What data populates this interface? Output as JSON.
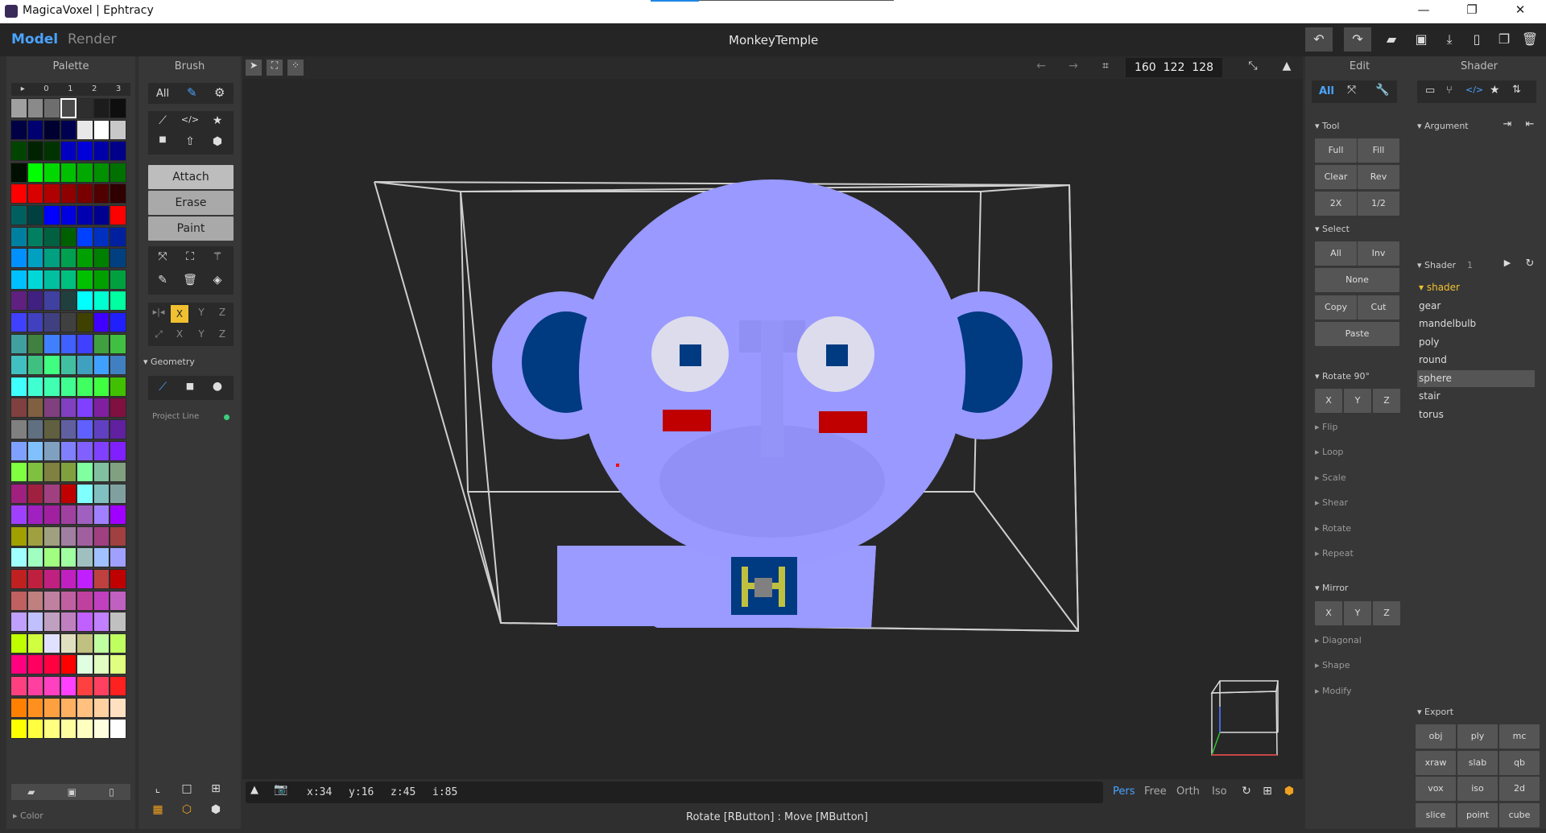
{
  "window": {
    "title": "MagicaVoxel | Ephtracy",
    "minimize": "—",
    "maximize": "❐",
    "close": "✕"
  },
  "menubar": {
    "model_tab": "Model",
    "render_tab": "Render",
    "project_name": "MonkeyTemple"
  },
  "palette": {
    "title": "Palette",
    "pages": [
      "▸",
      "0",
      "1",
      "2",
      "3"
    ],
    "footer_label": "Color",
    "colors": [
      [
        "#a0a0a0",
        "#8a8a8a",
        "#6e6e6e",
        "#4a4a4a",
        "#2e2e2e",
        "#1c1c1c",
        "#0e0e0e"
      ],
      [
        "#000044",
        "#000070",
        "#000030",
        "#000050",
        "#e8e8e8",
        "#ffffff",
        "#c8c8c8"
      ],
      [
        "#004400",
        "#002200",
        "#003300",
        "#0000c0",
        "#0000d8",
        "#0000a8",
        "#000088"
      ],
      [
        "#001000",
        "#00ff00",
        "#00d800",
        "#00c000",
        "#00a800",
        "#009000",
        "#007000"
      ],
      [
        "#ff0000",
        "#d80000",
        "#b00000",
        "#900000",
        "#780000",
        "#500000",
        "#300000"
      ],
      [
        "#006060",
        "#004040",
        "#0000ff",
        "#0000e0",
        "#0000b0",
        "#000090",
        "#ff0000"
      ],
      [
        "#0080a0",
        "#008060",
        "#006040",
        "#006000",
        "#0040ff",
        "#0030c0",
        "#0020a0"
      ],
      [
        "#0090ff",
        "#00a0c0",
        "#00a080",
        "#00a050",
        "#00a000",
        "#008000",
        "#004080"
      ],
      [
        "#00c0ff",
        "#00d8d8",
        "#00c0a0",
        "#00c080",
        "#00c000",
        "#00a000",
        "#00a040"
      ],
      [
        "#602080",
        "#402080",
        "#4040a0",
        "#204040",
        "#00ffff",
        "#00ffd0",
        "#00ffa0"
      ],
      [
        "#4040ff",
        "#4040c0",
        "#404080",
        "#404040",
        "#404000",
        "#4000ff",
        "#2020ff"
      ],
      [
        "#40a0a0",
        "#408040",
        "#4080ff",
        "#4060ff",
        "#4040ff",
        "#40a040",
        "#40c040"
      ],
      [
        "#40c0c0",
        "#40c080",
        "#40ff80",
        "#40c0a0",
        "#40a0c0",
        "#40a0ff",
        "#4080c0"
      ],
      [
        "#40ffff",
        "#40ffd0",
        "#40ffb0",
        "#40ff90",
        "#40ff60",
        "#40ff40",
        "#40c000"
      ],
      [
        "#804040",
        "#806040",
        "#804080",
        "#8040c0",
        "#8040ff",
        "#8020a0",
        "#801040"
      ],
      [
        "#808080",
        "#607080",
        "#606040",
        "#6060a0",
        "#6060ff",
        "#6040c0",
        "#6020a0"
      ],
      [
        "#80a0ff",
        "#80c0ff",
        "#80a0c0",
        "#8080ff",
        "#8060ff",
        "#8040ff",
        "#8020ff"
      ],
      [
        "#80ff40",
        "#80c040",
        "#808040",
        "#80a040",
        "#80ffa0",
        "#80c0a0",
        "#80a080"
      ],
      [
        "#a02080",
        "#a02040",
        "#a04080",
        "#c00000",
        "#80ffff",
        "#80c0c0",
        "#80a0a0"
      ],
      [
        "#a040ff",
        "#a020c0",
        "#a020a0",
        "#a040a0",
        "#a060c0",
        "#a080ff",
        "#a000ff"
      ],
      [
        "#a0a000",
        "#a0a040",
        "#a0a080",
        "#a080a0",
        "#a060a0",
        "#a04080",
        "#a04040"
      ],
      [
        "#a0ffff",
        "#a0ffc0",
        "#a0ff80",
        "#a0ffa0",
        "#a0c0c0",
        "#a0c0ff",
        "#a0a0ff"
      ],
      [
        "#c02020",
        "#c02040",
        "#c02080",
        "#c020c0",
        "#c020ff",
        "#c04040",
        "#c00000"
      ],
      [
        "#c06060",
        "#c08080",
        "#c080a0",
        "#c060a0",
        "#c040a0",
        "#c040c0",
        "#c060c0"
      ],
      [
        "#c0a0ff",
        "#c0c0ff",
        "#c0a0c0",
        "#c080c0",
        "#c060ff",
        "#c080ff",
        "#c0c0c0"
      ],
      [
        "#c0ff00",
        "#d0ff40",
        "#e0e0ff",
        "#e0e0c0",
        "#c0c080",
        "#c0ffa0",
        "#c0ff60"
      ],
      [
        "#ff0080",
        "#ff0060",
        "#ff0040",
        "#ff0000",
        "#e0ffe0",
        "#e0ffc0",
        "#e0ff80"
      ],
      [
        "#ff4080",
        "#ff40a0",
        "#ff40c0",
        "#ff40ff",
        "#ff4040",
        "#ff4060",
        "#ff2020"
      ],
      [
        "#ff8000",
        "#ff9020",
        "#ffa040",
        "#ffb060",
        "#ffc080",
        "#ffd0a0",
        "#ffe0c0"
      ],
      [
        "#ffff00",
        "#ffff40",
        "#ffff80",
        "#ffffa0",
        "#ffffc0",
        "#ffffe0",
        "#ffffff"
      ]
    ]
  },
  "brush": {
    "title": "Brush",
    "all_label": "All",
    "modes": {
      "attach": "Attach",
      "erase": "Erase",
      "paint": "Paint"
    },
    "axes": {
      "x": "X",
      "y": "Y",
      "z": "Z"
    },
    "geometry_label": "Geometry",
    "project_line_label": "Project Line"
  },
  "toolbar": {
    "size_x": "160",
    "size_y": "122",
    "size_z": "128"
  },
  "status": {
    "x": "x:34",
    "y": "y:16",
    "z": "z:45",
    "i": "i:85",
    "hint": "Rotate [RButton] : Move [MButton]"
  },
  "view": {
    "pers": "Pers",
    "free": "Free",
    "orth": "Orth",
    "iso": "Iso"
  },
  "edit": {
    "title": "Edit",
    "all_label": "All",
    "tool_label": "Tool",
    "tool_buttons": [
      "Full",
      "Fill",
      "Clear",
      "Rev",
      "2X",
      "1/2"
    ],
    "select_label": "Select",
    "select_all": "All",
    "select_inv": "Inv",
    "select_none": "None",
    "copy": "Copy",
    "cut": "Cut",
    "paste": "Paste",
    "rotate_label": "Rotate 90°",
    "rotate_axes": [
      "X",
      "Y",
      "Z"
    ],
    "collapsed": [
      "Flip",
      "Loop",
      "Scale",
      "Shear",
      "Rotate",
      "Repeat"
    ],
    "mirror_label": "Mirror",
    "mirror_axes": [
      "X",
      "Y",
      "Z"
    ],
    "collapsed2": [
      "Diagonal",
      "Shape",
      "Modify"
    ]
  },
  "shader": {
    "title": "Shader",
    "argument_label": "Argument",
    "shader_label": "Shader",
    "shader_count": "1",
    "items": [
      "shader",
      "gear",
      "mandelbulb",
      "poly",
      "round",
      "sphere",
      "stair",
      "torus"
    ],
    "selected": "sphere",
    "export_label": "Export",
    "export_buttons": [
      "obj",
      "ply",
      "mc",
      "xraw",
      "slab",
      "qb",
      "vox",
      "iso",
      "2d",
      "slice",
      "point",
      "cube"
    ]
  },
  "colors": {
    "accent": "#4aa3ff",
    "voxel": "#9999ff",
    "voxel_dark": "#8080ee",
    "eye_socket": "#003a80",
    "cheek": "#c00000"
  }
}
